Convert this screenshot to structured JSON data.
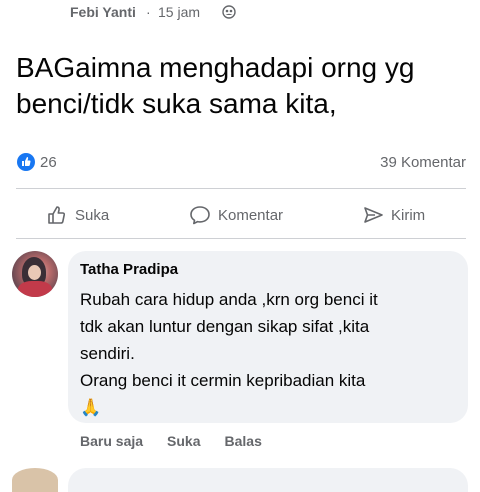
{
  "post": {
    "author": "Febi Yanti",
    "separator": "·",
    "time": "15 jam",
    "text": "BAGaimna menghadapi orng yg\nbenci/tidk suka sama kita,",
    "reaction_count": "26",
    "comment_count": "39 Komentar"
  },
  "actions": {
    "like": "Suka",
    "comment": "Komentar",
    "share": "Kirim"
  },
  "comment": {
    "author": "Tatha Pradipa",
    "text": "Rubah cara hidup anda ,krn org benci it\ntdk akan luntur dengan sikap sifat ,kita\nsendiri.\nOrang benci it cermin kepribadian kita",
    "emoji": "🙏",
    "time": "Baru saja",
    "like": "Suka",
    "reply": "Balas"
  },
  "colors": {
    "reaction_blue": "#1877f2",
    "meta_gray": "#65676b",
    "bubble_bg": "#f0f2f5"
  },
  "icons": {
    "privacy": "friends-icon",
    "reaction": "like-reaction-icon",
    "like": "thumbs-up-icon",
    "comment": "speech-bubble-icon",
    "share": "send-icon"
  }
}
